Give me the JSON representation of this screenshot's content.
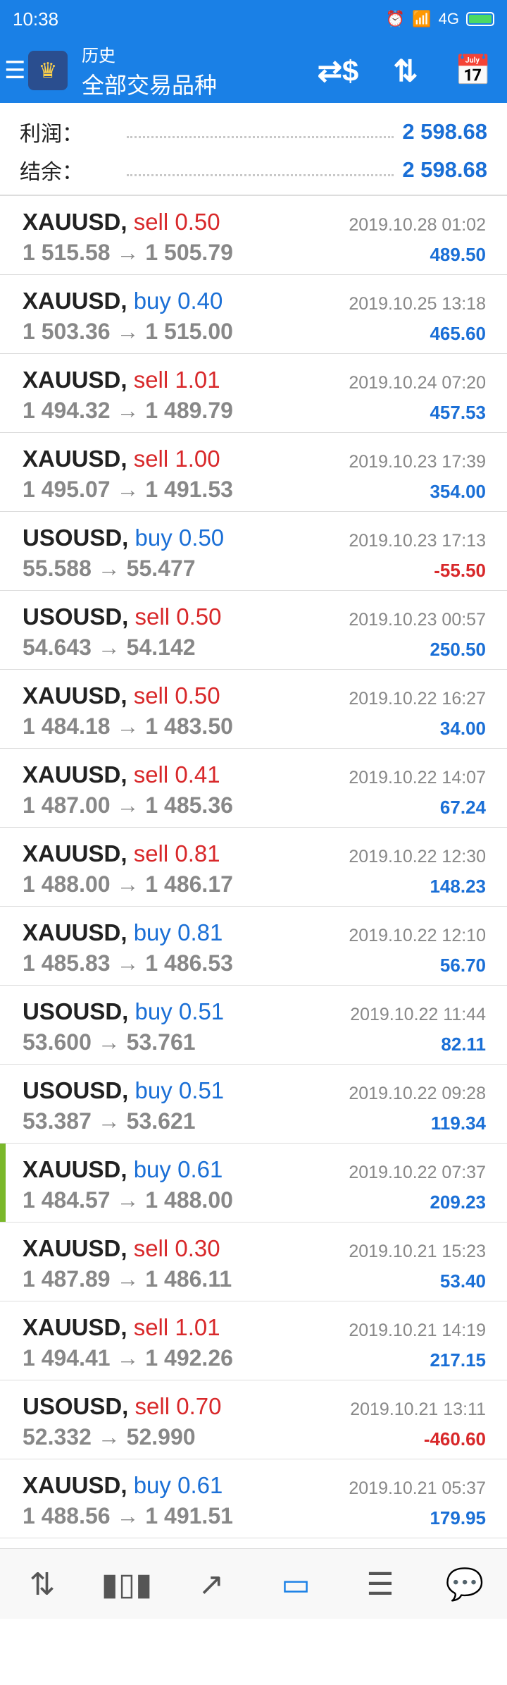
{
  "status_bar": {
    "time": "10:38",
    "network": "4G"
  },
  "app_bar": {
    "title": "历史",
    "subtitle": "全部交易品种"
  },
  "summary": {
    "profit_label": "利润：",
    "profit_value": "2 598.68",
    "balance_label": "结余：",
    "balance_value": "2 598.68"
  },
  "trades": [
    {
      "symbol": "XAUUSD,",
      "side": "sell",
      "volume": "0.50",
      "prices": "1 515.58 → 1 505.79",
      "datetime": "2019.10.28 01:02",
      "profit": "489.50"
    },
    {
      "symbol": "XAUUSD,",
      "side": "buy",
      "volume": "0.40",
      "prices": "1 503.36 → 1 515.00",
      "datetime": "2019.10.25 13:18",
      "profit": "465.60"
    },
    {
      "symbol": "XAUUSD,",
      "side": "sell",
      "volume": "1.01",
      "prices": "1 494.32 → 1 489.79",
      "datetime": "2019.10.24 07:20",
      "profit": "457.53"
    },
    {
      "symbol": "XAUUSD,",
      "side": "sell",
      "volume": "1.00",
      "prices": "1 495.07 → 1 491.53",
      "datetime": "2019.10.23 17:39",
      "profit": "354.00"
    },
    {
      "symbol": "USOUSD,",
      "side": "buy",
      "volume": "0.50",
      "prices": "55.588 → 55.477",
      "datetime": "2019.10.23 17:13",
      "profit": "-55.50"
    },
    {
      "symbol": "USOUSD,",
      "side": "sell",
      "volume": "0.50",
      "prices": "54.643 → 54.142",
      "datetime": "2019.10.23 00:57",
      "profit": "250.50"
    },
    {
      "symbol": "XAUUSD,",
      "side": "sell",
      "volume": "0.50",
      "prices": "1 484.18 → 1 483.50",
      "datetime": "2019.10.22 16:27",
      "profit": "34.00"
    },
    {
      "symbol": "XAUUSD,",
      "side": "sell",
      "volume": "0.41",
      "prices": "1 487.00 → 1 485.36",
      "datetime": "2019.10.22 14:07",
      "profit": "67.24"
    },
    {
      "symbol": "XAUUSD,",
      "side": "sell",
      "volume": "0.81",
      "prices": "1 488.00 → 1 486.17",
      "datetime": "2019.10.22 12:30",
      "profit": "148.23"
    },
    {
      "symbol": "XAUUSD,",
      "side": "buy",
      "volume": "0.81",
      "prices": "1 485.83 → 1 486.53",
      "datetime": "2019.10.22 12:10",
      "profit": "56.70"
    },
    {
      "symbol": "USOUSD,",
      "side": "buy",
      "volume": "0.51",
      "prices": "53.600 → 53.761",
      "datetime": "2019.10.22 11:44",
      "profit": "82.11"
    },
    {
      "symbol": "USOUSD,",
      "side": "buy",
      "volume": "0.51",
      "prices": "53.387 → 53.621",
      "datetime": "2019.10.22 09:28",
      "profit": "119.34"
    },
    {
      "symbol": "XAUUSD,",
      "side": "buy",
      "volume": "0.61",
      "prices": "1 484.57 → 1 488.00",
      "datetime": "2019.10.22 07:37",
      "profit": "209.23"
    },
    {
      "symbol": "XAUUSD,",
      "side": "sell",
      "volume": "0.30",
      "prices": "1 487.89 → 1 486.11",
      "datetime": "2019.10.21 15:23",
      "profit": "53.40"
    },
    {
      "symbol": "XAUUSD,",
      "side": "sell",
      "volume": "1.01",
      "prices": "1 494.41 → 1 492.26",
      "datetime": "2019.10.21 14:19",
      "profit": "217.15"
    },
    {
      "symbol": "USOUSD,",
      "side": "sell",
      "volume": "0.70",
      "prices": "52.332 → 52.990",
      "datetime": "2019.10.21 13:11",
      "profit": "-460.60"
    },
    {
      "symbol": "XAUUSD,",
      "side": "buy",
      "volume": "0.61",
      "prices": "1 488.56 → 1 491.51",
      "datetime": "2019.10.21 05:37",
      "profit": "179.95"
    }
  ],
  "bottom_nav": {
    "items": [
      "quotes-icon",
      "chart-icon",
      "trade-icon",
      "history-icon",
      "news-icon",
      "chat-icon"
    ],
    "active": "history-icon"
  },
  "colors": {
    "accent": "#1a80e6",
    "sell": "#d8282a",
    "buy": "#1a6fd6",
    "selected": "#7ab82a"
  }
}
